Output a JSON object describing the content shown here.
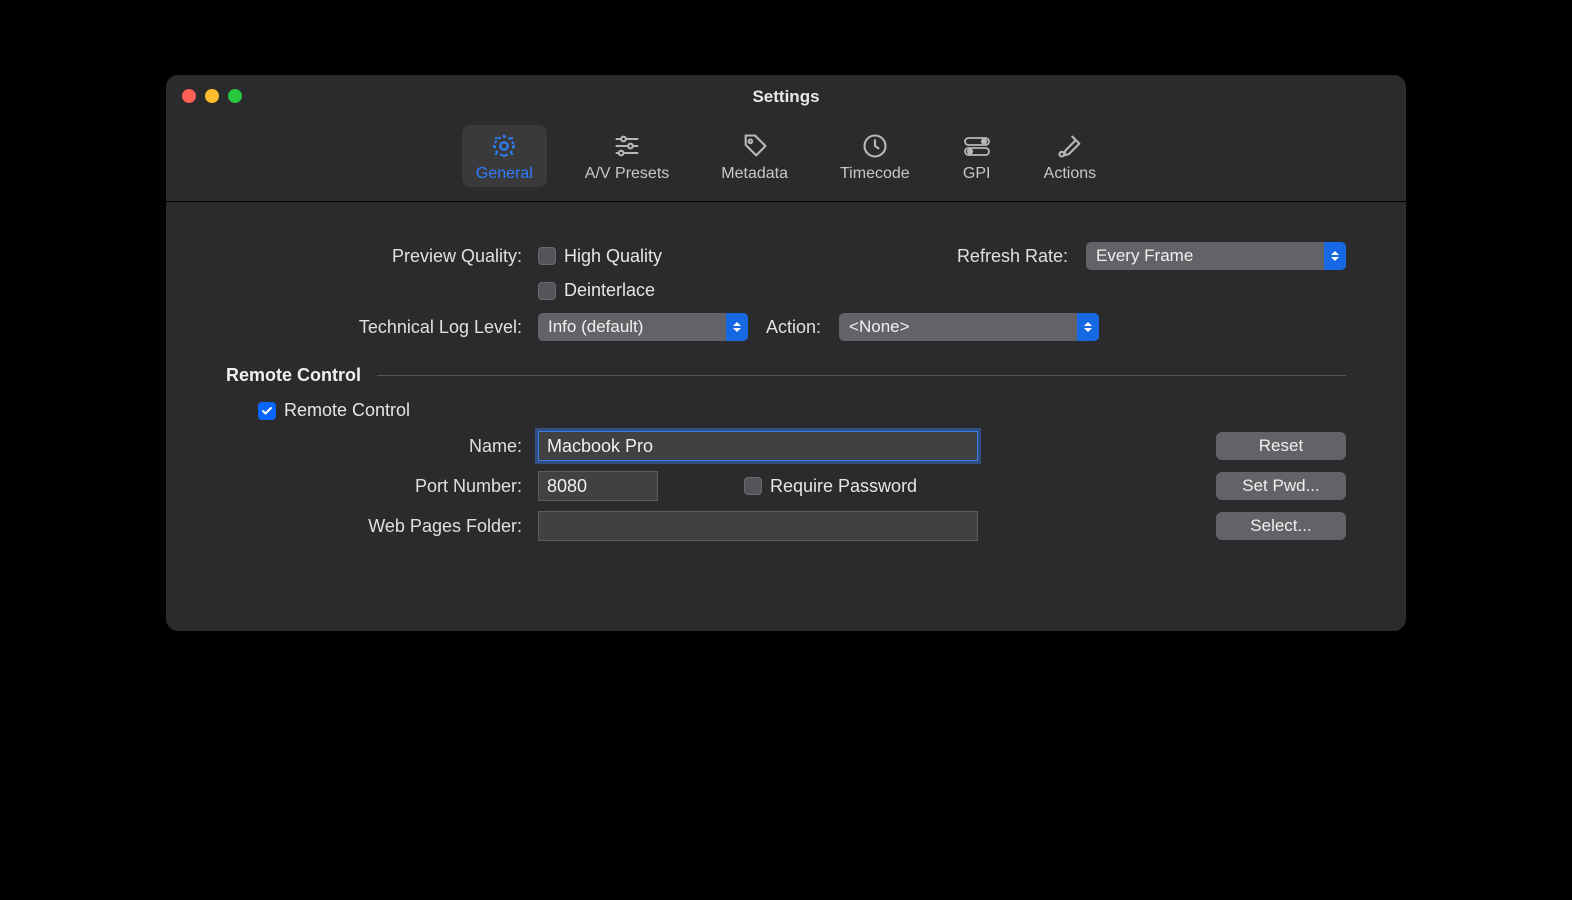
{
  "window": {
    "title": "Settings"
  },
  "tabs": [
    {
      "label": "General"
    },
    {
      "label": "A/V Presets"
    },
    {
      "label": "Metadata"
    },
    {
      "label": "Timecode"
    },
    {
      "label": "GPI"
    },
    {
      "label": "Actions"
    }
  ],
  "general": {
    "preview_quality_label": "Preview Quality:",
    "high_quality_label": "High Quality",
    "deinterlace_label": "Deinterlace",
    "refresh_rate_label": "Refresh Rate:",
    "refresh_rate_value": "Every Frame",
    "log_level_label": "Technical Log Level:",
    "log_level_value": "Info (default)",
    "action_label": "Action:",
    "action_value": "<None>"
  },
  "remote": {
    "section_title": "Remote Control",
    "enable_label": "Remote Control",
    "name_label": "Name:",
    "name_value": "Macbook Pro",
    "reset_label": "Reset",
    "port_label": "Port Number:",
    "port_value": "8080",
    "require_password_label": "Require Password",
    "set_pwd_label": "Set Pwd...",
    "web_folder_label": "Web Pages Folder:",
    "web_folder_value": "",
    "select_label": "Select..."
  }
}
